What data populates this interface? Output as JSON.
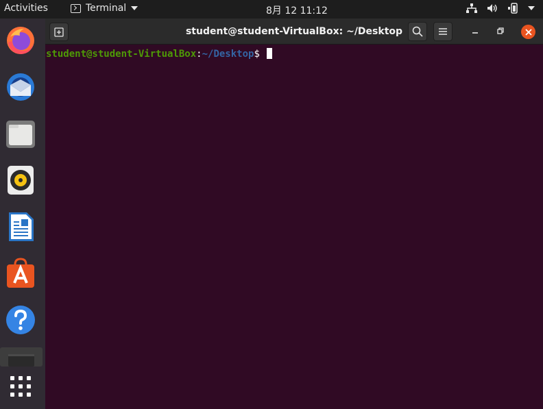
{
  "topbar": {
    "activities": "Activities",
    "app_name": "Terminal",
    "clock": "8月 12  11:12"
  },
  "dock": {
    "items": [
      "Firefox",
      "Thunderbird",
      "Files",
      "Rhythmbox",
      "LibreOffice Writer",
      "Ubuntu Software",
      "Help",
      "Terminal",
      "Show Applications"
    ]
  },
  "window": {
    "title": "student@student-VirtualBox: ~/Desktop"
  },
  "terminal": {
    "prompt_user": "student@student-VirtualBox",
    "prompt_colon": ":",
    "prompt_path": "~/Desktop",
    "prompt_dollar": "$"
  },
  "colors": {
    "terminal_bg": "#300a24",
    "prompt_user": "#4e9a06",
    "prompt_path": "#3465a4",
    "close_button": "#e95420"
  }
}
